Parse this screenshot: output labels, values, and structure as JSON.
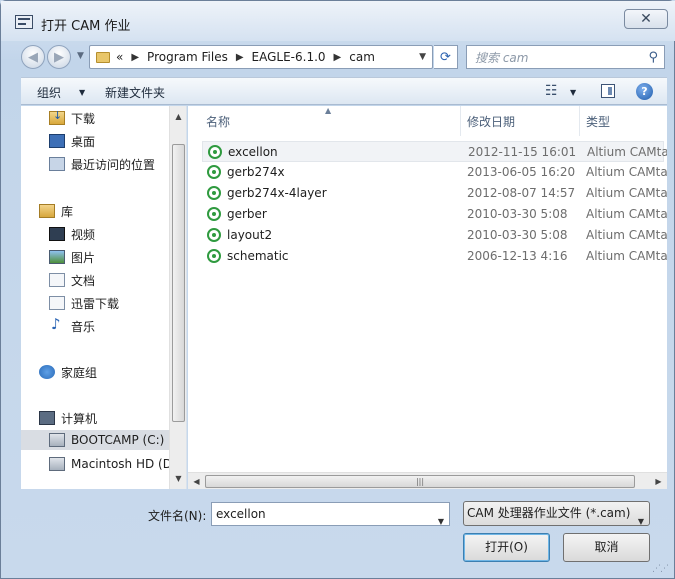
{
  "window": {
    "title": "打开 CAM 作业",
    "close_label": "✕"
  },
  "nav": {
    "back_icon": "◀",
    "forward_icon": "▶",
    "breadcrumb_prefix": "«",
    "breadcrumb": [
      "Program Files",
      "EAGLE-6.1.0",
      "cam"
    ],
    "refresh_icon": "⟳",
    "search_placeholder": "搜索 cam"
  },
  "toolbar": {
    "organize_label": "组织",
    "new_folder_label": "新建文件夹",
    "view_icon": "view-icon",
    "help_label": "?"
  },
  "sidebar": {
    "favorites": [
      {
        "label": "下载",
        "icon": "download-folder-icon"
      },
      {
        "label": "桌面",
        "icon": "desktop-icon"
      },
      {
        "label": "最近访问的位置",
        "icon": "recent-places-icon"
      }
    ],
    "library_label": "库",
    "libraries": [
      {
        "label": "视频",
        "icon": "video-library-icon"
      },
      {
        "label": "图片",
        "icon": "pictures-library-icon"
      },
      {
        "label": "文档",
        "icon": "documents-library-icon"
      },
      {
        "label": "迅雷下载",
        "icon": "xunlei-download-icon"
      },
      {
        "label": "音乐",
        "icon": "music-library-icon"
      }
    ],
    "homegroup_label": "家庭组",
    "computer_label": "计算机",
    "drives": [
      {
        "label": "BOOTCAMP (C:)",
        "icon": "drive-icon",
        "selected": true
      },
      {
        "label": "Macintosh HD (D",
        "icon": "drive-icon",
        "selected": false
      }
    ]
  },
  "columns": {
    "name": "名称",
    "date": "修改日期",
    "type": "类型"
  },
  "files": [
    {
      "name": "excellon",
      "date": "2012-11-15 16:01",
      "type": "Altium CAMtas",
      "selected": true
    },
    {
      "name": "gerb274x",
      "date": "2013-06-05 16:20",
      "type": "Altium CAMtas",
      "selected": false
    },
    {
      "name": "gerb274x-4layer",
      "date": "2012-08-07 14:57",
      "type": "Altium CAMtas",
      "selected": false
    },
    {
      "name": "gerber",
      "date": "2010-03-30 5:08",
      "type": "Altium CAMtas",
      "selected": false
    },
    {
      "name": "layout2",
      "date": "2010-03-30 5:08",
      "type": "Altium CAMtas",
      "selected": false
    },
    {
      "name": "schematic",
      "date": "2006-12-13 4:16",
      "type": "Altium CAMtas",
      "selected": false
    }
  ],
  "footer": {
    "filename_label": "文件名(N):",
    "filename_value": "excellon",
    "filter_value": "CAM 处理器作业文件 (*.cam)",
    "open_label": "打开(O)",
    "cancel_label": "取消"
  },
  "colors": {
    "file_icon": "#2f9a3f",
    "accent": "#1f5cab"
  }
}
